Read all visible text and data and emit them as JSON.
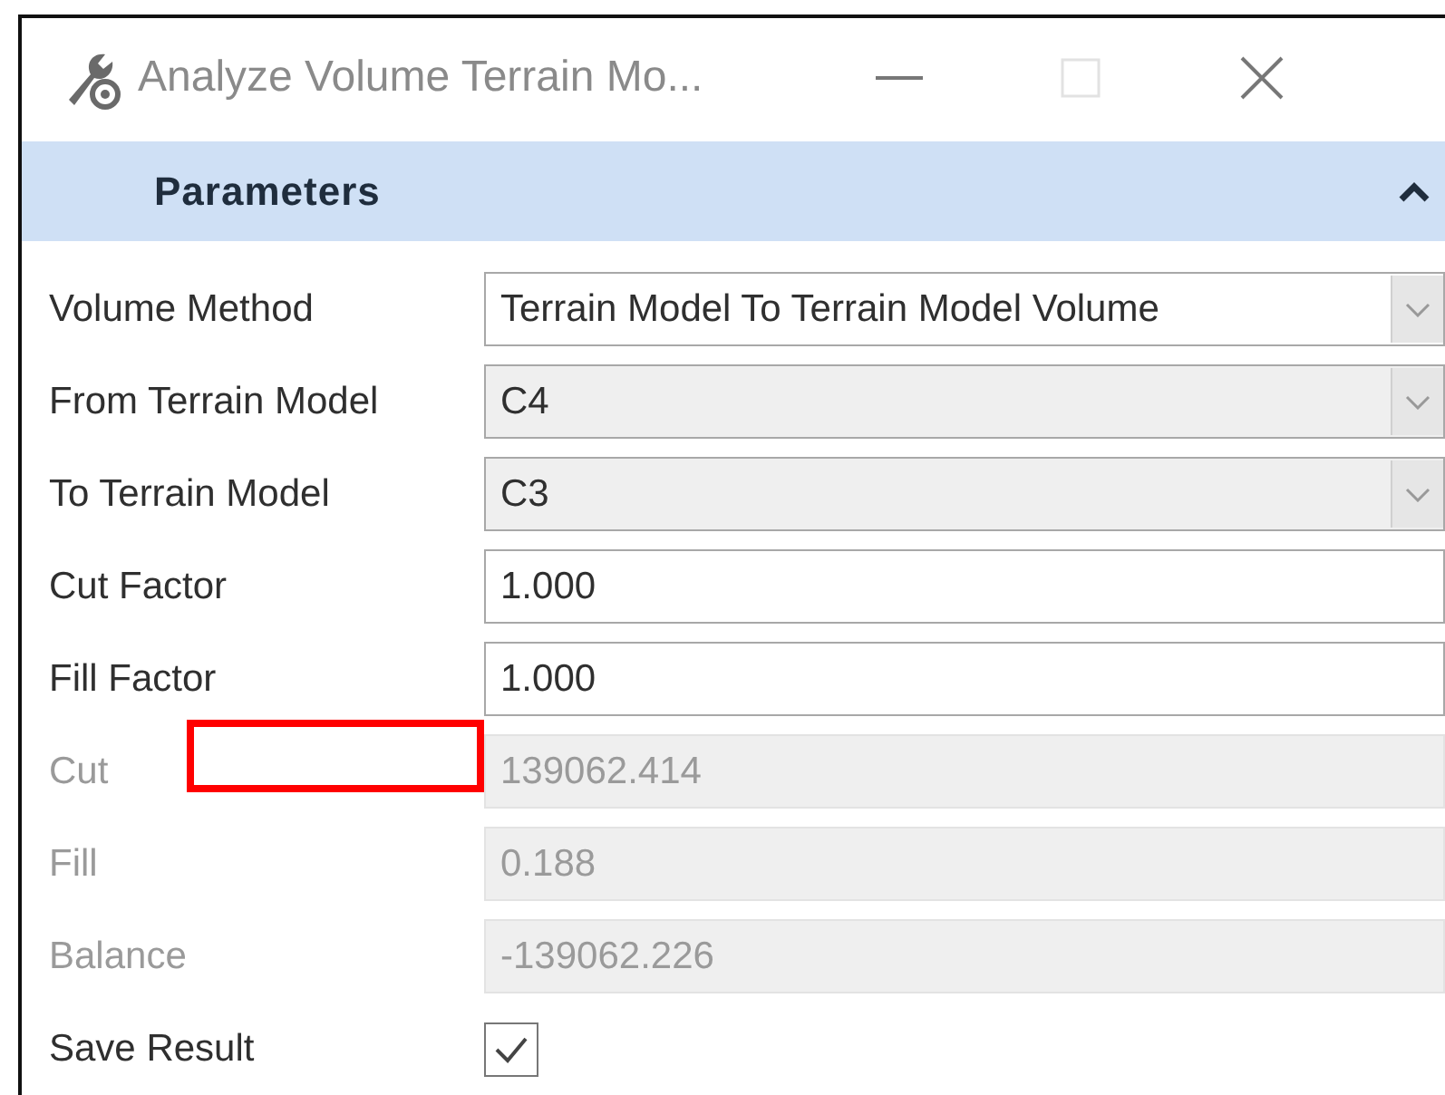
{
  "window": {
    "title": "Analyze Volume Terrain Mo..."
  },
  "section": {
    "title": "Parameters",
    "expanded": true
  },
  "rows": [
    {
      "label": "Volume Method",
      "kind": "dropdown",
      "value": "Terrain Model To Terrain Model Volume",
      "disabled": false,
      "highlighted": false
    },
    {
      "label": "From Terrain Model",
      "kind": "dropdown",
      "value": "C4",
      "disabled": true,
      "highlighted": false
    },
    {
      "label": "To Terrain Model",
      "kind": "dropdown",
      "value": "C3",
      "disabled": true,
      "highlighted": false
    },
    {
      "label": "Cut Factor",
      "kind": "input",
      "value": "1.000",
      "disabled": false,
      "highlighted": false
    },
    {
      "label": "Fill Factor",
      "kind": "input",
      "value": "1.000",
      "disabled": false,
      "highlighted": false
    },
    {
      "label": "Cut",
      "kind": "input",
      "value": "139062.414",
      "disabled": true,
      "highlighted": true
    },
    {
      "label": "Fill",
      "kind": "input",
      "value": "0.188",
      "disabled": true,
      "highlighted": false
    },
    {
      "label": "Balance",
      "kind": "input",
      "value": "-139062.226",
      "disabled": true,
      "highlighted": false
    },
    {
      "label": "Save Result",
      "kind": "checkbox",
      "checked": true,
      "highlighted": false
    }
  ]
}
